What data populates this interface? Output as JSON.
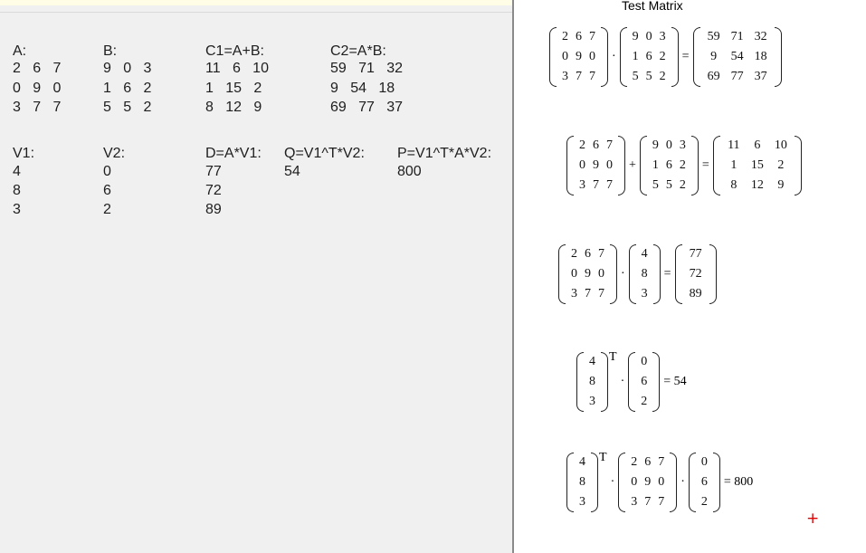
{
  "title": "Test Matrix",
  "left": {
    "A": {
      "label": "A:",
      "rows": [
        "2   6   7",
        "0   9   0",
        "3   7   7"
      ]
    },
    "B": {
      "label": "B:",
      "rows": [
        "9   0   3",
        "1   6   2",
        "5   5   2"
      ]
    },
    "C1": {
      "label": "C1=A+B:",
      "rows": [
        "11   6   10",
        "1   15   2",
        "8   12   9"
      ]
    },
    "C2": {
      "label": "C2=A*B:",
      "rows": [
        "59   71   32",
        "9   54   18",
        "69   77   37"
      ]
    },
    "V1": {
      "label": "V1:",
      "rows": [
        "4",
        "8",
        "3"
      ]
    },
    "V2": {
      "label": "V2:",
      "rows": [
        "0",
        "6",
        "2"
      ]
    },
    "D": {
      "label": "D=A*V1:",
      "rows": [
        "77",
        "72",
        "89"
      ]
    },
    "Q": {
      "label": "Q=V1^T*V2:",
      "rows": [
        "54"
      ]
    },
    "P": {
      "label": "P=V1^T*A*V2:",
      "rows": [
        "800"
      ]
    }
  },
  "equations": [
    {
      "name": "eq-product",
      "terms": [
        {
          "m": [
            [
              "2",
              "6",
              "7"
            ],
            [
              "0",
              "9",
              "0"
            ],
            [
              "3",
              "7",
              "7"
            ]
          ]
        },
        {
          "op": "·"
        },
        {
          "m": [
            [
              "9",
              "0",
              "3"
            ],
            [
              "1",
              "6",
              "2"
            ],
            [
              "5",
              "5",
              "2"
            ]
          ]
        },
        {
          "op": "="
        },
        {
          "m": [
            [
              "59",
              "71",
              "32"
            ],
            [
              "9",
              "54",
              "18"
            ],
            [
              "69",
              "77",
              "37"
            ]
          ]
        }
      ]
    },
    {
      "name": "eq-sum",
      "terms": [
        {
          "m": [
            [
              "2",
              "6",
              "7"
            ],
            [
              "0",
              "9",
              "0"
            ],
            [
              "3",
              "7",
              "7"
            ]
          ]
        },
        {
          "op": "+"
        },
        {
          "m": [
            [
              "9",
              "0",
              "3"
            ],
            [
              "1",
              "6",
              "2"
            ],
            [
              "5",
              "5",
              "2"
            ]
          ]
        },
        {
          "op": "="
        },
        {
          "m": [
            [
              "11",
              "6",
              "10"
            ],
            [
              "1",
              "15",
              "2"
            ],
            [
              "8",
              "12",
              "9"
            ]
          ]
        }
      ]
    },
    {
      "name": "eq-mat-vec",
      "terms": [
        {
          "m": [
            [
              "2",
              "6",
              "7"
            ],
            [
              "0",
              "9",
              "0"
            ],
            [
              "3",
              "7",
              "7"
            ]
          ]
        },
        {
          "op": "·"
        },
        {
          "m": [
            [
              "4"
            ],
            [
              "8"
            ],
            [
              "3"
            ]
          ]
        },
        {
          "op": "="
        },
        {
          "m": [
            [
              "77"
            ],
            [
              "72"
            ],
            [
              "89"
            ]
          ]
        }
      ]
    },
    {
      "name": "eq-dot",
      "terms": [
        {
          "m": [
            [
              "4"
            ],
            [
              "8"
            ],
            [
              "3"
            ]
          ]
        },
        {
          "sup": "T"
        },
        {
          "op": "·"
        },
        {
          "m": [
            [
              "0"
            ],
            [
              "6"
            ],
            [
              "2"
            ]
          ]
        },
        {
          "op": "= 54"
        }
      ]
    },
    {
      "name": "eq-quadratic",
      "terms": [
        {
          "m": [
            [
              "4"
            ],
            [
              "8"
            ],
            [
              "3"
            ]
          ]
        },
        {
          "sup": "T"
        },
        {
          "op": "·"
        },
        {
          "m": [
            [
              "2",
              "6",
              "7"
            ],
            [
              "0",
              "9",
              "0"
            ],
            [
              "3",
              "7",
              "7"
            ]
          ]
        },
        {
          "op": "·"
        },
        {
          "m": [
            [
              "0"
            ],
            [
              "6"
            ],
            [
              "2"
            ]
          ]
        },
        {
          "op": "= 800"
        }
      ]
    }
  ],
  "cursor": "+"
}
